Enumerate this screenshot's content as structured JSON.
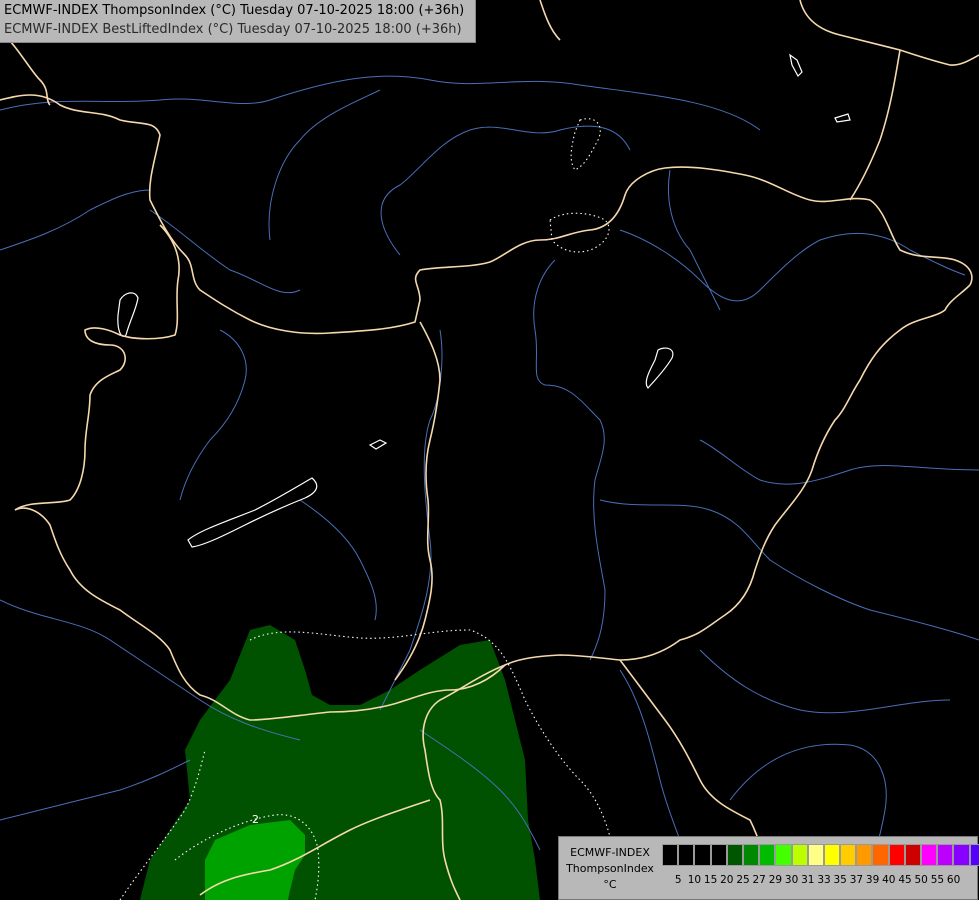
{
  "header": {
    "line1": "ECMWF-INDEX ThompsonIndex (°C) Tuesday 07-10-2025 18:00 (+36h)",
    "line2": "ECMWF-INDEX BestLiftedIndex (°C) Tuesday 07-10-2025 18:00 (+36h)"
  },
  "map": {
    "contour_label": "2",
    "colors": {
      "background": "#000000",
      "borders": "#f5d9ad",
      "rivers": "#4a6fb8",
      "lakes": "#ffffff",
      "shade_low": "#004d00",
      "shade_high": "#00a000",
      "contour": "#ffffff"
    }
  },
  "legend": {
    "line1": "ECMWF-INDEX",
    "line2": "ThompsonIndex",
    "line3": "°C",
    "colors": [
      "#000000",
      "#000000",
      "#000000",
      "#000000",
      "#005500",
      "#008800",
      "#00bb00",
      "#44ff00",
      "#bbff00",
      "#ffff88",
      "#ffff00",
      "#ffcc00",
      "#ff9900",
      "#ff6600",
      "#ff0000",
      "#cc0000",
      "#ff00ff",
      "#bb00ff",
      "#8800ff",
      "#5500ff",
      "#0000ff"
    ],
    "ticks": [
      "5",
      "10",
      "15",
      "20",
      "25",
      "27",
      "29",
      "30",
      "31",
      "33",
      "35",
      "37",
      "39",
      "40",
      "45",
      "50",
      "55",
      "60"
    ]
  }
}
